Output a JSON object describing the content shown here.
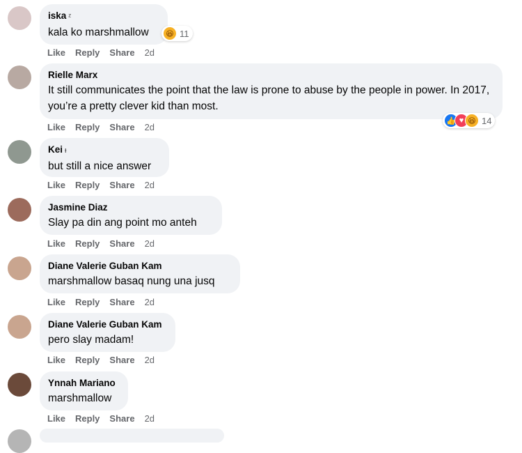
{
  "comments": [
    {
      "name": "iska",
      "name_mark": "ᶻ",
      "text": "kala ko marshmallow",
      "reaction_count": "11",
      "actions": {
        "like": "Like",
        "reply": "Reply",
        "share": "Share",
        "time": "2d"
      },
      "avatar_color": "#d9c7c7"
    },
    {
      "name": "Rielle Marx",
      "name_mark": "",
      "text": "It still communicates the point that the law is prone to abuse by the people in power. In 2017, you’re a pretty clever kid than most.",
      "reaction_count": "14",
      "actions": {
        "like": "Like",
        "reply": "Reply",
        "share": "Share",
        "time": "2d"
      },
      "avatar_color": "#b8a9a2"
    },
    {
      "name": "Kei",
      "name_mark": "ᵻ",
      "text": "but still a nice answer",
      "actions": {
        "like": "Like",
        "reply": "Reply",
        "share": "Share",
        "time": "2d"
      },
      "avatar_color": "#8f9890"
    },
    {
      "name": "Jasmine Diaz",
      "name_mark": "",
      "text": "Slay pa din ang point mo anteh",
      "actions": {
        "like": "Like",
        "reply": "Reply",
        "share": "Share",
        "time": "2d"
      },
      "avatar_color": "#9c6b5c"
    },
    {
      "name": "Diane Valerie Guban Kam",
      "name_mark": "",
      "text": "marshmallow basaq nung una jusq",
      "actions": {
        "like": "Like",
        "reply": "Reply",
        "share": "Share",
        "time": "2d"
      },
      "avatar_color": "#c9a58f"
    },
    {
      "name": "Diane Valerie Guban Kam",
      "name_mark": "",
      "text": "pero slay madam!",
      "actions": {
        "like": "Like",
        "reply": "Reply",
        "share": "Share",
        "time": "2d"
      },
      "avatar_color": "#c9a58f"
    },
    {
      "name": "Ynnah Mariano",
      "name_mark": "",
      "text": "marshmallow",
      "actions": {
        "like": "Like",
        "reply": "Reply",
        "share": "Share",
        "time": "2d"
      },
      "avatar_color": "#6b4a3a"
    }
  ],
  "colors": {
    "bubble": "#f0f2f5",
    "meta": "#65676b",
    "like": "#1877f2",
    "love": "#f33e58",
    "haha": "#f7b125"
  }
}
